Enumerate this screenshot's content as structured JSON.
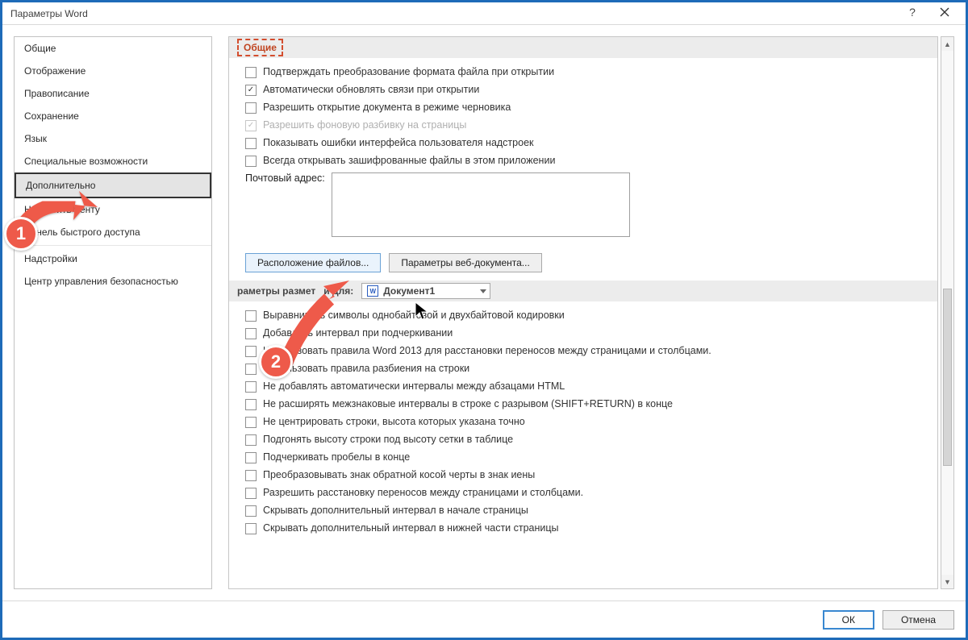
{
  "window": {
    "title": "Параметры Word"
  },
  "sidebar": {
    "items": [
      "Общие",
      "Отображение",
      "Правописание",
      "Сохранение",
      "Язык",
      "Специальные возможности",
      "Дополнительно",
      "Настроить ленту",
      "Панель быстрого доступа",
      "Надстройки",
      "Центр управления безопасностью"
    ],
    "selected_index": 6
  },
  "section_general": {
    "title": "Общие",
    "checks": [
      {
        "label": "Подтверждать преобразование формата файла при открытии",
        "checked": false,
        "disabled": false
      },
      {
        "label": "Автоматически обновлять связи при открытии",
        "checked": true,
        "disabled": false
      },
      {
        "label": "Разрешить открытие документа в режиме черновика",
        "checked": false,
        "disabled": false
      },
      {
        "label": "Разрешить фоновую разбивку на страницы",
        "checked": true,
        "disabled": true
      },
      {
        "label": "Показывать ошибки интерфейса пользователя надстроек",
        "checked": false,
        "disabled": false
      },
      {
        "label": "Всегда открывать зашифрованные файлы в этом приложении",
        "checked": false,
        "disabled": false
      }
    ],
    "mail_label": "Почтовый адрес:",
    "buttons": {
      "file_locations": "Расположение файлов...",
      "web_options": "Параметры веб-документа..."
    }
  },
  "section_layout": {
    "title_prefix": "раметры размет",
    "title_suffix": "и для:",
    "document": "Документ1",
    "checks": [
      "Выравнивать символы однобайтовой и двухбайтовой кодировки",
      "Добавлять интервал при подчеркивании",
      "Использовать правила Word 2013 для расстановки переносов между страницами и столбцами.",
      "Использовать правила разбиения на строки",
      "Не добавлять автоматически интервалы между абзацами HTML",
      "Не расширять межзнаковые интервалы в строке с разрывом (SHIFT+RETURN) в конце",
      "Не центрировать строки, высота которых указана точно",
      "Подгонять высоту строки под высоту сетки в таблице",
      "Подчеркивать пробелы в конце",
      "Преобразовывать знак обратной косой черты в знак иены",
      "Разрешить расстановку переносов между страницами и столбцами.",
      "Скрывать дополнительный интервал в начале страницы",
      "Скрывать дополнительный интервал в нижней части страницы"
    ]
  },
  "footer": {
    "ok": "ОК",
    "cancel": "Отмена"
  },
  "annotations": {
    "n1": "1",
    "n2": "2"
  }
}
